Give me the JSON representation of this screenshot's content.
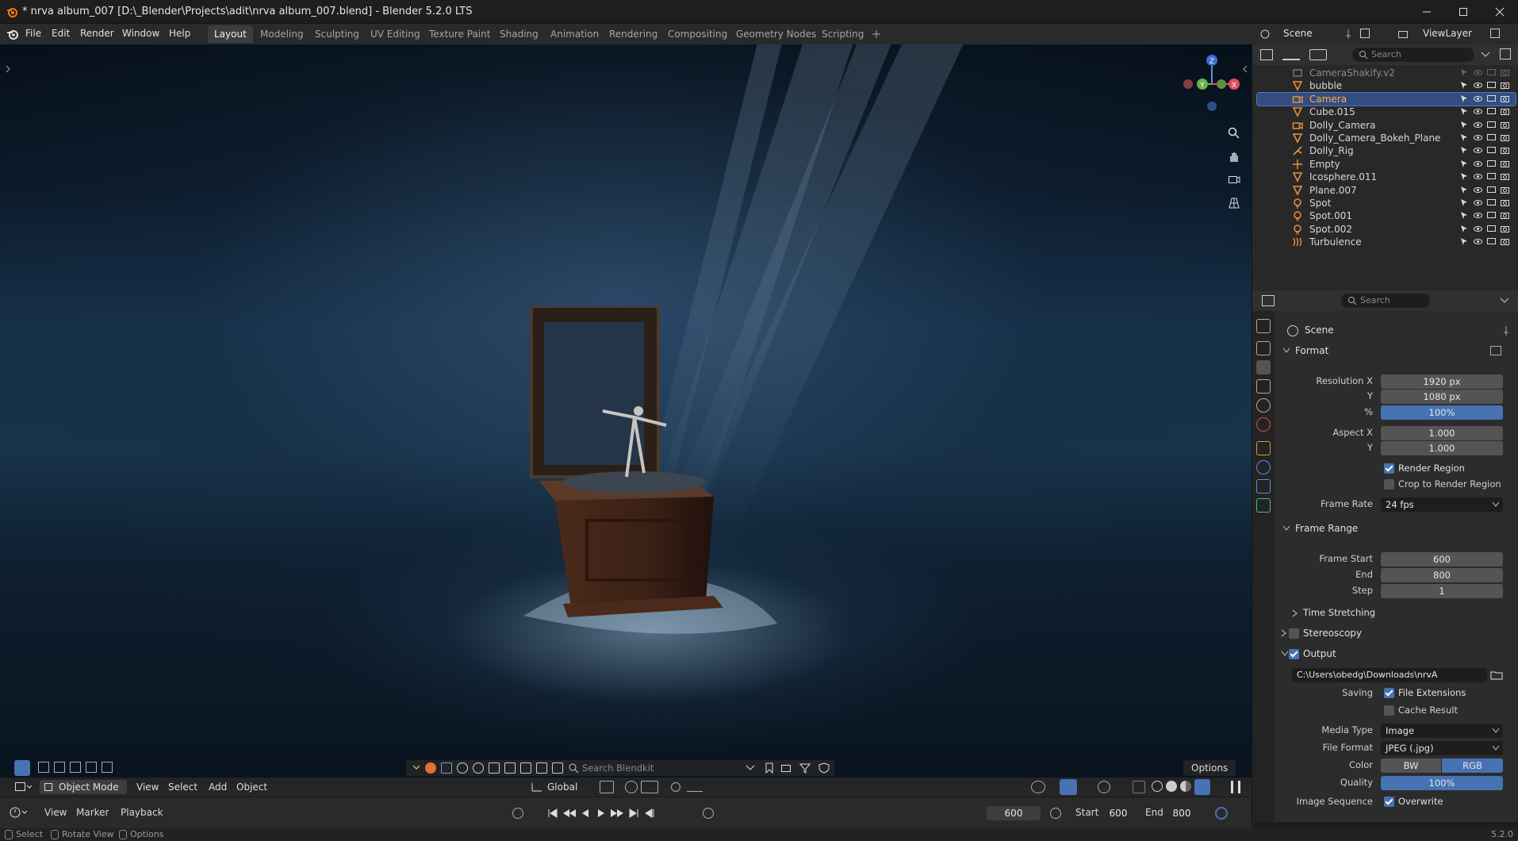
{
  "window": {
    "title": "* nrva album_007 [D:\\_Blender\\Projects\\adit\\nrva album_007.blend] - Blender 5.2.0 LTS"
  },
  "menu": {
    "items": [
      "File",
      "Edit",
      "Render",
      "Window",
      "Help"
    ]
  },
  "workspaces": [
    "Layout",
    "Modeling",
    "Sculpting",
    "UV Editing",
    "Texture Paint",
    "Shading",
    "Animation",
    "Rendering",
    "Compositing",
    "Geometry Nodes",
    "Scripting"
  ],
  "active_workspace": "Layout",
  "scene_bar": {
    "scene": "Scene",
    "view_layer": "ViewLayer"
  },
  "outliner": {
    "search_placeholder": "Search",
    "items": [
      {
        "name": "CameraShakify.v2",
        "icon": "collection-icon",
        "selected": false,
        "dim": true
      },
      {
        "name": "bubble",
        "icon": "mesh-icon",
        "selected": false
      },
      {
        "name": "Camera",
        "icon": "camera-icon",
        "selected": true
      },
      {
        "name": "Cube.015",
        "icon": "mesh-icon",
        "selected": false
      },
      {
        "name": "Dolly_Camera",
        "icon": "camera-icon",
        "selected": false
      },
      {
        "name": "Dolly_Camera_Bokeh_Plane",
        "icon": "mesh-icon",
        "selected": false
      },
      {
        "name": "Dolly_Rig",
        "icon": "armature-icon",
        "selected": false
      },
      {
        "name": "Empty",
        "icon": "empty-icon",
        "selected": false
      },
      {
        "name": "Icosphere.011",
        "icon": "mesh-icon",
        "selected": false
      },
      {
        "name": "Plane.007",
        "icon": "mesh-icon",
        "selected": false
      },
      {
        "name": "Spot",
        "icon": "light-icon",
        "selected": false
      },
      {
        "name": "Spot.001",
        "icon": "light-icon",
        "selected": false
      },
      {
        "name": "Spot.002",
        "icon": "light-icon",
        "selected": false
      },
      {
        "name": "Turbulence",
        "icon": "force-field-icon",
        "selected": false
      }
    ]
  },
  "properties": {
    "search_placeholder": "Search",
    "context": "Scene",
    "format": {
      "header": "Format",
      "resolution_x_label": "Resolution X",
      "resolution_x": "1920 px",
      "y_label": "Y",
      "resolution_y": "1080 px",
      "pct_label": "%",
      "resolution_pct": "100%",
      "aspect_x_label": "Aspect X",
      "aspect_x": "1.000",
      "aspect_y_label": "Y",
      "aspect_y": "1.000",
      "render_region": "Render Region",
      "crop_region": "Crop to Render Region",
      "frame_rate_label": "Frame Rate",
      "frame_rate": "24 fps"
    },
    "frame_range": {
      "header": "Frame Range",
      "start_label": "Frame Start",
      "start": "600",
      "end_label": "End",
      "end": "800",
      "step_label": "Step",
      "step": "1",
      "time_stretching": "Time Stretching"
    },
    "stereoscopy": "Stereoscopy",
    "output": {
      "header": "Output",
      "path": "C:\\Users\\obedg\\Downloads\\nrvA",
      "saving_label": "Saving",
      "file_extensions": "File Extensions",
      "cache_result": "Cache Result",
      "media_type_label": "Media Type",
      "media_type": "Image",
      "file_format_label": "File Format",
      "file_format": "JPEG (.jpg)",
      "color_label": "Color",
      "color_bw": "BW",
      "color_rgb": "RGB",
      "quality_label": "Quality",
      "quality": "100%",
      "image_sequence_label": "Image Sequence",
      "overwrite": "Overwrite"
    }
  },
  "viewport": {
    "mode": "Object Mode",
    "menus": [
      "View",
      "Select",
      "Add",
      "Object"
    ],
    "transform_orientation": "Global",
    "blendkit_search": "Search Blendkit",
    "options": "Options",
    "gizmo": {
      "x": "X",
      "y": "Y",
      "z": "Z"
    }
  },
  "timeline": {
    "menus": [
      "View",
      "Marker",
      "Playback"
    ],
    "current_frame": "600",
    "start_label": "Start",
    "start": "600",
    "end_label": "End",
    "end": "800"
  },
  "statusbar": {
    "select": "Select",
    "rotate": "Rotate View",
    "options": "Options",
    "version": "5.2.0"
  },
  "colors": {
    "accent_blue": "#4772b3",
    "selection_orange": "#ffaf3c",
    "object_icon_orange": "#e8913a"
  }
}
